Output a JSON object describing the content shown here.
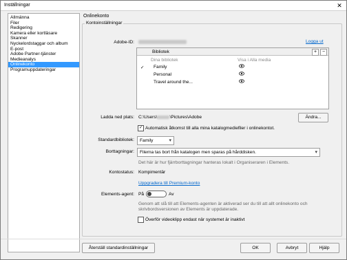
{
  "window": {
    "title": "Inställningar",
    "close_label": "✕"
  },
  "sidebar": {
    "items": [
      {
        "label": "Allmänna",
        "selected": false
      },
      {
        "label": "Filer",
        "selected": false
      },
      {
        "label": "Redigering",
        "selected": false
      },
      {
        "label": "Kamera eller kortläsare",
        "selected": false
      },
      {
        "label": "Skanner",
        "selected": false
      },
      {
        "label": "Nyckelordstaggar och album",
        "selected": false
      },
      {
        "label": "E-post",
        "selected": false
      },
      {
        "label": "Adobe Partner-tjänster",
        "selected": false
      },
      {
        "label": "Medieanalys",
        "selected": false
      },
      {
        "label": "Onlinekonto",
        "selected": true
      },
      {
        "label": "Programuppdateringar",
        "selected": false
      }
    ]
  },
  "main": {
    "section_title": "Onlinekonto",
    "group_title": "Kontoinställningar",
    "adobe_id_label": "Adobe-ID:",
    "logout_link": "Logga ut",
    "libraries": {
      "header": "Bibliotek",
      "add_label": "+",
      "remove_label": "−",
      "col_libraries": "Dina bibliotek",
      "col_show": "Visa i Alla media",
      "rows": [
        {
          "name": "Family",
          "checked": true
        },
        {
          "name": "Personal",
          "checked": false
        },
        {
          "name": "Travel around the...",
          "checked": false
        }
      ],
      "check_mark": "✓",
      "eye_icon": "eye-icon"
    },
    "download_location": {
      "label": "Ladda ned plats:",
      "path_prefix": "C:\\Users\\",
      "path_suffix": "\\Pictures\\Adobe",
      "browse_button": "Ändra..."
    },
    "auto_sync": {
      "checked": true,
      "label": "Automatisk åtkomst till alla mina katalogmediefiler i onlinekontot."
    },
    "default_library": {
      "label": "Standardbibliotek:",
      "value": "Family"
    },
    "deletions": {
      "label": "Borttagningar:",
      "value": "Filerna tas bort från katalogen men sparas på hårddisken.",
      "help": "Det här är hur fjärrborttagningar hanteras lokalt i Organiseraren i Elements."
    },
    "account_status": {
      "label": "Kontostatus:",
      "value": "Kompimentär",
      "upgrade_link": "Uppgradera till Premium-konto"
    },
    "elements_agent": {
      "label": "Elements-agent:",
      "on_label": "På",
      "off_label": "Av",
      "state": "off",
      "help_line1": "Genom att slå till att Elements-agenten är aktiverad ser du till att allt onlinekonto och",
      "help_line2": "skrivbordsversionen av Elements är uppdaterade."
    },
    "video_transfer": {
      "checked": false,
      "label": "Överför videoklipp endast när systemet är inaktivt"
    }
  },
  "footer": {
    "reset_button": "Återställ standardinställningar",
    "ok_button": "OK",
    "cancel_button": "Avbryt",
    "help_button": "Hjälp"
  }
}
